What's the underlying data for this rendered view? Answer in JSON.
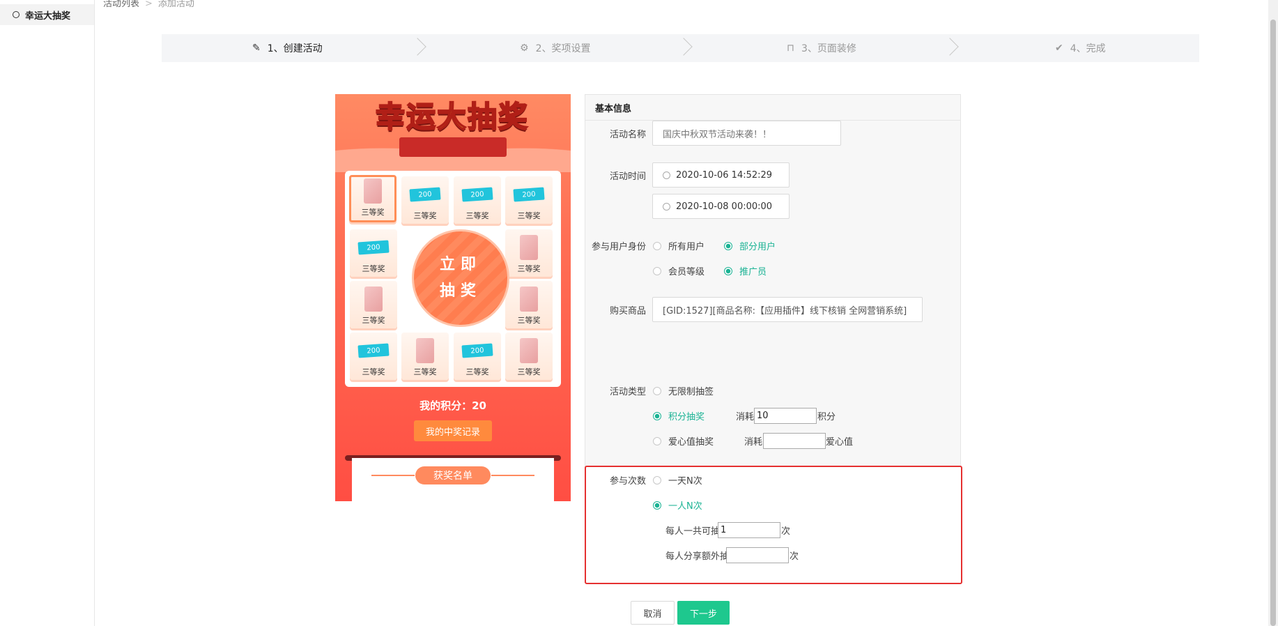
{
  "sidebar": {
    "active_item": "幸运大抽奖"
  },
  "breadcrumb": {
    "parent": "活动列表",
    "separator": ">",
    "current": "添加活动"
  },
  "steps": [
    {
      "label": "1、创建活动",
      "icon": "pencil-icon",
      "active": true
    },
    {
      "label": "2、奖项设置",
      "icon": "gear-icon",
      "active": false
    },
    {
      "label": "3、页面装修",
      "icon": "bag-icon",
      "active": false
    },
    {
      "label": "4、完成",
      "icon": "check-circle-icon",
      "active": false
    }
  ],
  "preview": {
    "title_white": "幸运",
    "title_yellow": "大抽奖",
    "prize_label": "三等奖",
    "coupon_text": "200",
    "draw_line1": "立即",
    "draw_line2": "抽奖",
    "score_text": "我的积分：20",
    "record_button": "我的中奖记录",
    "winners_title": "获奖名单"
  },
  "form": {
    "section_title": "基本信息",
    "activity_name": {
      "label": "活动名称",
      "placeholder": "国庆中秋双节活动来袭！！"
    },
    "activity_time": {
      "label": "活动时间",
      "start": "2020-10-06 14:52:29",
      "end": "2020-10-08 00:00:00"
    },
    "user_identity": {
      "label": "参与用户身份",
      "options": [
        {
          "label": "所有用户",
          "checked": false
        },
        {
          "label": "部分用户",
          "checked": true
        },
        {
          "label": "会员等级",
          "checked": false
        },
        {
          "label": "推广员",
          "checked": true
        }
      ]
    },
    "purchase_goods": {
      "label": "购买商品",
      "value": "[GID:1527][商品名称:【应用插件】线下核销 全网营销系统]"
    },
    "activity_type": {
      "label": "活动类型",
      "unlimited": {
        "label": "无限制抽签",
        "checked": false
      },
      "points": {
        "label": "积分抽奖",
        "checked": true,
        "consume": "消耗",
        "value": "10",
        "unit": "积分"
      },
      "love": {
        "label": "爱心值抽奖",
        "checked": false,
        "consume": "消耗",
        "value": "",
        "unit": "爱心值"
      }
    },
    "participation": {
      "label": "参与次数",
      "per_day": {
        "label": "一天N次",
        "checked": false
      },
      "per_person": {
        "label": "一人N次",
        "checked": true
      },
      "total_label": "每人一共可抽",
      "total_value": "1",
      "total_unit": "次",
      "share_label": "每人分享额外抽",
      "share_value": "",
      "share_unit": "次"
    }
  },
  "buttons": {
    "cancel": "取消",
    "next": "下一步"
  },
  "colors": {
    "accent": "#1bb394",
    "next_button": "#1ec88e",
    "highlight_border": "#e53030",
    "preview_bg": "#ff5a45"
  }
}
